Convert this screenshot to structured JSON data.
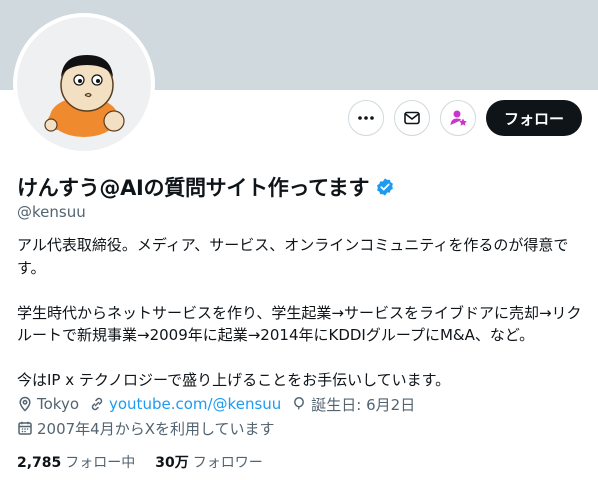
{
  "profile": {
    "display_name": "けんすう@AIの質問サイト作ってます",
    "handle": "@kensuu",
    "verified": true,
    "bio": {
      "p1": "アル代表取締役。メディア、サービス、オンラインコミュニティを作るのが得意です。",
      "p2": "学生時代からネットサービスを作り、学生起業→サービスをライブドアに売却→リクルートで新規事業→2009年に起業→2014年にKDDIグループにM&A、など。",
      "p3": "今はIP x テクノロジーで盛り上げることをお手伝いしています。"
    },
    "location": "Tokyo",
    "website": "youtube.com/@kensuu",
    "birthday": "誕生日: 6月2日",
    "joined": "2007年4月からXを利用しています"
  },
  "stats": {
    "following_count": "2,785",
    "following_label": "フォロー中",
    "followers_count": "30万",
    "followers_label": "フォロワー"
  },
  "actions": {
    "follow_label": "フォロー"
  },
  "colors": {
    "banner": "#cfd9de",
    "verified": "#1d9bf0",
    "link": "#1d9bf0",
    "subscribe_icon": "#c936cc",
    "follow_bg": "#0f1419"
  },
  "icons": [
    "more-icon",
    "message-icon",
    "subscribe-icon",
    "verified-badge-icon",
    "location-icon",
    "link-icon",
    "birthday-icon",
    "calendar-icon"
  ]
}
